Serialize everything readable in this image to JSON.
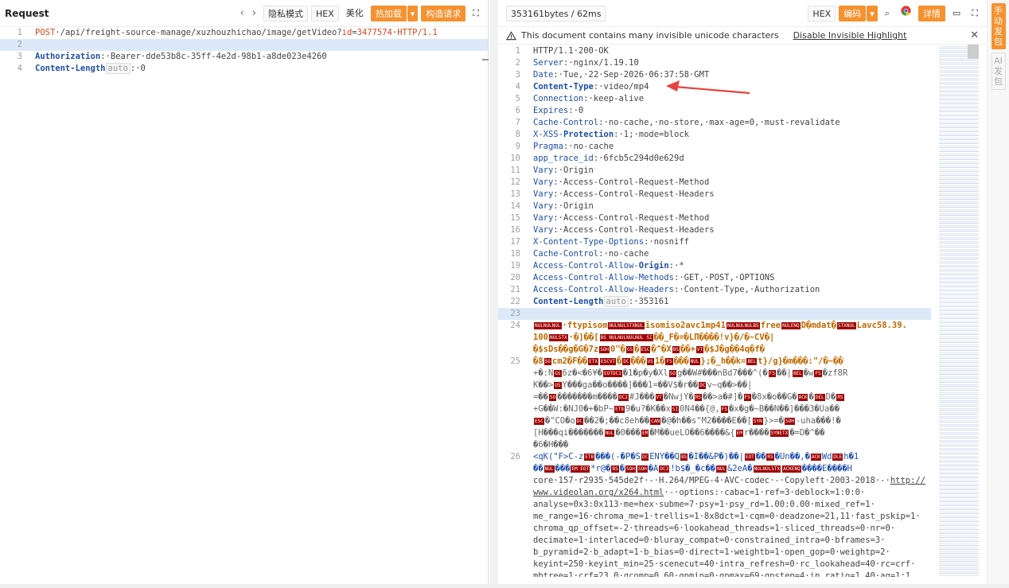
{
  "request": {
    "title": "Request",
    "nav_back": "‹",
    "nav_fwd": "›",
    "privacy": "隐私模式",
    "hex": "HEX",
    "beautify": "美化",
    "hotload": "热加载",
    "hotload_caret": "▾",
    "build": "构造请求",
    "expand_icon": "⛶",
    "lines": [
      [
        "1",
        [
          [
            "m",
            "POST"
          ],
          [
            "",
            "·/api/freight-source-manage/xuzhouzhichao/image/getVideo?"
          ],
          [
            "m",
            "id"
          ],
          [
            "",
            "="
          ],
          [
            "m",
            "3477574"
          ],
          [
            "",
            "·"
          ],
          [
            "m",
            "HTTP/1.1"
          ]
        ]
      ],
      [
        "2",
        [
          [
            "hl",
            "                    "
          ]
        ]
      ],
      [
        "3",
        [
          [
            "kb",
            "Authorization"
          ],
          [
            "",
            ":·Bearer·dde53b8c-35ff-4e2d-98b1-a8de023e4260"
          ]
        ]
      ],
      [
        "4",
        [
          [
            "kb",
            "Content-Length"
          ],
          [
            "a",
            "auto"
          ],
          [
            "",
            ":·0"
          ]
        ]
      ]
    ]
  },
  "response": {
    "summary": "353161bytes / 62ms",
    "hex": "HEX",
    "encoding": "编码",
    "encoding_caret": "▾",
    "search_icon": "⌕",
    "details": "详情",
    "comment_icon": "▭",
    "expand_icon": "⛶",
    "warning": "This document contains many invisible unicode characters",
    "warning_action": "Disable Invisible Highlight",
    "warning_close": "✕",
    "lines": [
      [
        "1",
        [
          [
            "",
            "HTTP/1.1·200·OK"
          ]
        ]
      ],
      [
        "2",
        [
          [
            "k",
            "Server"
          ],
          [
            "",
            ":·nginx/1.19.10"
          ]
        ]
      ],
      [
        "3",
        [
          [
            "k",
            "Date"
          ],
          [
            "",
            ":·Tue,·22·Sep·2026·06:37:58·GMT"
          ]
        ]
      ],
      [
        "4",
        [
          [
            "kb",
            "Content-Type"
          ],
          [
            "",
            ":·video/mp4"
          ]
        ]
      ],
      [
        "5",
        [
          [
            "k",
            "Connection"
          ],
          [
            "",
            ":·keep-alive"
          ]
        ]
      ],
      [
        "6",
        [
          [
            "k",
            "Expires"
          ],
          [
            "",
            ":·0"
          ]
        ]
      ],
      [
        "7",
        [
          [
            "k",
            "Cache-Control"
          ],
          [
            "",
            ":·no-cache,·no-store,·max-age=0,·must-revalidate"
          ]
        ]
      ],
      [
        "8",
        [
          [
            "k",
            "X-XSS-"
          ],
          [
            "kb",
            "Protection"
          ],
          [
            "",
            ":·1;·mode=block"
          ]
        ]
      ],
      [
        "9",
        [
          [
            "k",
            "Pragma"
          ],
          [
            "",
            ":·no-cache"
          ]
        ]
      ],
      [
        "10",
        [
          [
            "k",
            "app_trace_id"
          ],
          [
            "",
            ":·6fcb5c294d0e629d"
          ]
        ]
      ],
      [
        "11",
        [
          [
            "k",
            "Vary"
          ],
          [
            "",
            ":·Origin"
          ]
        ]
      ],
      [
        "12",
        [
          [
            "k",
            "Vary"
          ],
          [
            "",
            ":·Access-Control-Request-Method"
          ]
        ]
      ],
      [
        "13",
        [
          [
            "k",
            "Vary"
          ],
          [
            "",
            ":·Access-Control-Request-Headers"
          ]
        ]
      ],
      [
        "14",
        [
          [
            "k",
            "Vary"
          ],
          [
            "",
            ":·Origin"
          ]
        ]
      ],
      [
        "15",
        [
          [
            "k",
            "Vary"
          ],
          [
            "",
            ":·Access-Control-Request-Method"
          ]
        ]
      ],
      [
        "16",
        [
          [
            "k",
            "Vary"
          ],
          [
            "",
            ":·Access-Control-Request-Headers"
          ]
        ]
      ],
      [
        "17",
        [
          [
            "k",
            "X-Content-Type-Options"
          ],
          [
            "",
            ":·nosniff"
          ]
        ]
      ],
      [
        "18",
        [
          [
            "k",
            "Cache-Control"
          ],
          [
            "",
            ":·no-cache"
          ]
        ]
      ],
      [
        "19",
        [
          [
            "k",
            "Access-Control-Allow-"
          ],
          [
            "kb",
            "Origin"
          ],
          [
            "",
            ":·*"
          ]
        ]
      ],
      [
        "20",
        [
          [
            "k",
            "Access-Control-Allow-Methods"
          ],
          [
            "",
            ":·GET,·POST,·OPTIONS"
          ]
        ]
      ],
      [
        "21",
        [
          [
            "k",
            "Access-Control-Allow-Headers"
          ],
          [
            "",
            ":·Content-Type,·Authorization"
          ]
        ]
      ],
      [
        "22",
        [
          [
            "kb",
            "Content-Length"
          ],
          [
            "a",
            "auto"
          ],
          [
            "",
            ":·353161"
          ]
        ]
      ],
      [
        "23",
        [
          [
            "hl",
            " "
          ]
        ]
      ],
      [
        "24",
        [
          [
            "c",
            "NULNULNUL"
          ],
          [
            "bin",
            "·ftypisom"
          ],
          [
            "c",
            "NULNULSTXNUL"
          ],
          [
            "bin",
            "isomiso2avc1mp41"
          ],
          [
            "c",
            "NULNULNULBS"
          ],
          [
            "bin",
            "free"
          ],
          [
            "c",
            "NULENQ"
          ],
          [
            "bin",
            "D�mdat�"
          ],
          [
            "c",
            "STXNUL"
          ],
          [
            "bin",
            "Lavc58.39."
          ]
        ]
      ],
      [
        "",
        [
          [
            "bin",
            "100"
          ],
          [
            "c",
            "NULSTX"
          ],
          [
            "bin",
            "·�]��["
          ],
          [
            "c",
            "BS NULNULNULNUL SI"
          ],
          [
            "bin",
            "��_F�=�LΠ����!v}�/�~CV�|"
          ]
        ]
      ],
      [
        "",
        [
          [
            "bin",
            "�$sDs��g�G�7z"
          ],
          [
            "c",
            "SOH"
          ],
          [
            "bin",
            "0\"�"
          ],
          [
            "c",
            "GS"
          ],
          [
            "bin",
            "�"
          ],
          [
            "c",
            "ESC"
          ],
          [
            "bin",
            "�^�X"
          ],
          [
            "c",
            "BS"
          ],
          [
            "bin",
            "��+"
          ],
          [
            "c",
            "VT"
          ],
          [
            "bin",
            "�$J�g��4q�f�"
          ]
        ]
      ],
      [
        "25",
        [
          [
            "bin",
            "�8"
          ],
          [
            "c",
            "SO"
          ],
          [
            "bin",
            "cm2�F��"
          ],
          [
            "c",
            "ETX"
          ],
          [
            "c",
            "ESCVT"
          ],
          [
            "bin",
            "�"
          ],
          [
            "c",
            "DC"
          ],
          [
            "bin",
            "���"
          ],
          [
            "c",
            "US"
          ],
          [
            "bin",
            "1�"
          ],
          [
            "c",
            "FS"
          ],
          [
            "bin",
            "���"
          ],
          [
            "c",
            "NUL"
          ],
          [
            "bin",
            "};�_h��k="
          ],
          [
            "c",
            "BEL"
          ],
          [
            "bin",
            "t}/g}�m���:\"/�~��"
          ]
        ]
      ],
      [
        "",
        [
          [
            "binb",
            "+�:N"
          ],
          [
            "c",
            "GS"
          ],
          [
            "binb",
            "6z�<�6¥�"
          ],
          [
            "c",
            "EOTDC1"
          ],
          [
            "binb",
            "�1�p�y�Xl"
          ],
          [
            "c",
            "SO"
          ],
          [
            "binb",
            "g��W#���nBd7���^(�"
          ],
          [
            "c",
            "FS"
          ],
          [
            "binb",
            "��|"
          ],
          [
            "c",
            "BEL"
          ],
          [
            "binb",
            "�w"
          ],
          [
            "c",
            "FS"
          ],
          [
            "binb",
            "�zf8R"
          ]
        ]
      ],
      [
        "",
        [
          [
            "binb",
            "K��>"
          ],
          [
            "c",
            "US"
          ],
          [
            "binb",
            "Y���ga��o����]���1=��V$�r��"
          ],
          [
            "c",
            "DC"
          ],
          [
            "binb",
            "v~q��>��|"
          ]
        ]
      ],
      [
        "",
        [
          [
            "binb",
            "=��"
          ],
          [
            "c",
            "SO"
          ],
          [
            "binb",
            "�������m����"
          ],
          [
            "c",
            "DC2"
          ],
          [
            "binb",
            "#J���"
          ],
          [
            "c",
            "VT"
          ],
          [
            "binb",
            "�NwjY�"
          ],
          [
            "c",
            "RS"
          ],
          [
            "binb",
            "��>a�#]�"
          ],
          [
            "c",
            "FS"
          ],
          [
            "binb",
            "�8x�o��G�"
          ],
          [
            "c",
            "ACK"
          ],
          [
            "binb",
            "�"
          ],
          [
            "c",
            "DEL"
          ],
          [
            "binb",
            "D�"
          ],
          [
            "c",
            "RS"
          ]
        ]
      ],
      [
        "",
        [
          [
            "binb",
            "+G��W:�NJ0�+�bP~"
          ],
          [
            "c",
            "ETB"
          ],
          [
            "binb",
            "9�u?�K��x"
          ],
          [
            "c",
            "SI"
          ],
          [
            "binb",
            "0N4��{@,"
          ],
          [
            "c",
            "FS"
          ],
          [
            "binb",
            "�x�g�~B��N��]���3�Ua��"
          ]
        ]
      ],
      [
        "",
        [
          [
            "c",
            "ESC"
          ],
          [
            "binb",
            "�\"CO�o"
          ],
          [
            "c",
            "DC"
          ],
          [
            "binb",
            "��2�;��c8eh��"
          ],
          [
            "c",
            "CAN"
          ],
          [
            "binb",
            "�@�h��s\"M2����E��["
          ],
          [
            "c",
            "SYN"
          ],
          [
            "binb",
            "}>=�"
          ],
          [
            "c",
            "SOH"
          ],
          [
            "binb",
            "-uha���!�"
          ]
        ]
      ],
      [
        "",
        [
          [
            "binb",
            "[H���qi�������"
          ],
          [
            "c",
            "NUL"
          ],
          [
            "binb",
            "�0���"
          ],
          [
            "c",
            "EM"
          ],
          [
            "binb",
            "�M��ueLO��6����&{"
          ],
          [
            "c",
            "EM"
          ],
          [
            "binb",
            "r����"
          ],
          [
            "c",
            "SYNETX"
          ],
          [
            "binb",
            "�=D�^��"
          ]
        ]
      ],
      [
        "",
        [
          [
            "binb",
            "�6�H���"
          ]
        ]
      ],
      [
        "26",
        [
          [
            "k",
            "<qK(\"F>C-z"
          ],
          [
            "c",
            "ETB"
          ],
          [
            "k",
            "���(-�P�S"
          ],
          [
            "c",
            "DC"
          ],
          [
            "k",
            "ENY��Q"
          ],
          [
            "c",
            "BS"
          ],
          [
            "k",
            "�I��&P�)��|"
          ],
          [
            "c",
            "EOT"
          ],
          [
            "k",
            "��"
          ],
          [
            "c",
            "RS"
          ],
          [
            "k",
            "�Un��,�"
          ],
          [
            "c",
            "ACK"
          ],
          [
            "k",
            "Wd"
          ],
          [
            "c",
            "DLE"
          ],
          [
            "k",
            "h�1"
          ]
        ]
      ],
      [
        "",
        [
          [
            "k",
            "��"
          ],
          [
            "c",
            "NUL"
          ],
          [
            "k",
            "���"
          ],
          [
            "c",
            "EM EOT"
          ],
          [
            "k",
            "*r@�"
          ],
          [
            "c",
            "BS"
          ],
          [
            "k",
            "�"
          ],
          [
            "c",
            "SOH"
          ],
          [
            "c",
            "SOH"
          ],
          [
            "k",
            "�A"
          ],
          [
            "c",
            "DC3"
          ],
          [
            "k",
            "!b$�_�c��"
          ],
          [
            "c",
            "NUL"
          ],
          [
            "k",
            "&2eA�"
          ],
          [
            "c",
            "NULNULSTX"
          ],
          [
            "c",
            "ACKENQ"
          ],
          [
            "k",
            "����E����H"
          ]
        ]
      ],
      [
        "",
        [
          [
            "",
            "core·157·r2935·545de2f·-·H.264/MPEG-4·AVC·codec·-·Copyleft·2003-2018·-·"
          ],
          [
            "u",
            "http://"
          ]
        ]
      ],
      [
        "",
        [
          [
            "u",
            "www.videolan.org/x264.html"
          ],
          [
            "",
            "·-·options:·cabac=1·ref=3·deblock=1:0:0·"
          ]
        ]
      ],
      [
        "",
        [
          [
            "",
            "analyse=0x3:0x113·me=hex·subme=7·psy=1·psy_rd=1.00:0.00·mixed_ref=1·"
          ]
        ]
      ],
      [
        "",
        [
          [
            "",
            "me_range=16·chroma_me=1·trellis=1·8x8dct=1·cqm=0·deadzone=21,11·fast_pskip=1·"
          ]
        ]
      ],
      [
        "",
        [
          [
            "",
            "chroma_qp_offset=-2·threads=6·lookahead_threads=1·sliced_threads=0·nr=0·"
          ]
        ]
      ],
      [
        "",
        [
          [
            "",
            "decimate=1·interlaced=0·bluray_compat=0·constrained_intra=0·bframes=3·"
          ]
        ]
      ],
      [
        "",
        [
          [
            "",
            "b_pyramid=2·b_adapt=1·b_bias=0·direct=1·weightb=1·open_gop=0·weightp=2·"
          ]
        ]
      ],
      [
        "",
        [
          [
            "",
            "keyint=250·keyint_min=25·scenecut=40·intra_refresh=0·rc_lookahead=40·rc=crf·"
          ]
        ]
      ],
      [
        "",
        [
          [
            "",
            "mbtree=1·crf=23.0·qcomp=0.60·qpmin=0·qpmax=69·qpstep=4·ip_ratio=1.40·aq=1:1."
          ]
        ]
      ]
    ]
  },
  "sidebar": {
    "manual": "手动发包",
    "ai": "AI发包"
  }
}
